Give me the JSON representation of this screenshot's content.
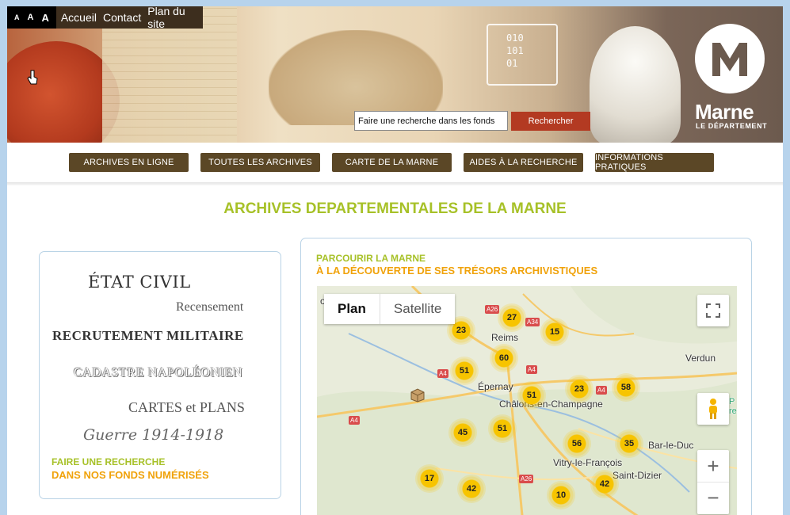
{
  "header": {
    "font_sizes": [
      "A",
      "A",
      "A"
    ],
    "links": [
      "Accueil",
      "Contact",
      "Plan du site"
    ],
    "binary": "010\n101\n01",
    "brand": "Marne",
    "brand_sub": "LE DÉPARTEMENT",
    "search": {
      "value": "Faire une recherche dans les fonds",
      "button": "Rechercher"
    }
  },
  "nav": [
    "ARCHIVES EN LIGNE",
    "TOUTES LES ARCHIVES",
    "CARTE DE LA MARNE",
    "AIDES À LA RECHERCHE",
    "INFORMATIONS PRATIQUES"
  ],
  "page_title": "ARCHIVES DEPARTEMENTALES DE LA MARNE",
  "left_card": {
    "etat_civil": "ÉTAT CIVIL",
    "recensement": "Recensement",
    "recrutement": "RECRUTEMENT MILITAIRE",
    "cadastre": "CADASTRE NAPOLÉONIEN",
    "cartes": "CARTES et PLANS",
    "guerre": "Guerre 1914-1918",
    "footer_line1": "FAIRE UNE RECHERCHE",
    "footer_line2": "DANS NOS FONDS NUMÉRISÉS"
  },
  "map_card": {
    "line1": "PARCOURIR LA MARNE",
    "line2": "À LA DÉCOUVERTE DE SES TRÉSORS ARCHIVISTIQUES",
    "map_types": [
      "Plan",
      "Satellite"
    ],
    "places": [
      "Reims",
      "Épernay",
      "Châlons-en-Champagne",
      "Verdun",
      "Bar-le-Duc",
      "Vitry-le-François",
      "Saint-Dizier"
    ],
    "roads": [
      "A26",
      "A34",
      "A4",
      "A4",
      "A4",
      "A4",
      "A26"
    ],
    "clusters": [
      "23",
      "27",
      "15",
      "60",
      "51",
      "51",
      "23",
      "58",
      "45",
      "51",
      "56",
      "35",
      "17",
      "42",
      "10",
      "42"
    ],
    "zoom_in": "+",
    "zoom_out": "−",
    "edge_label_top": "om",
    "edge_label_right": "P\nre"
  },
  "colors": {
    "accent_green": "#a7c128",
    "accent_orange": "#f0a20a",
    "nav_brown": "#5b4726",
    "search_button": "#b33a22"
  }
}
